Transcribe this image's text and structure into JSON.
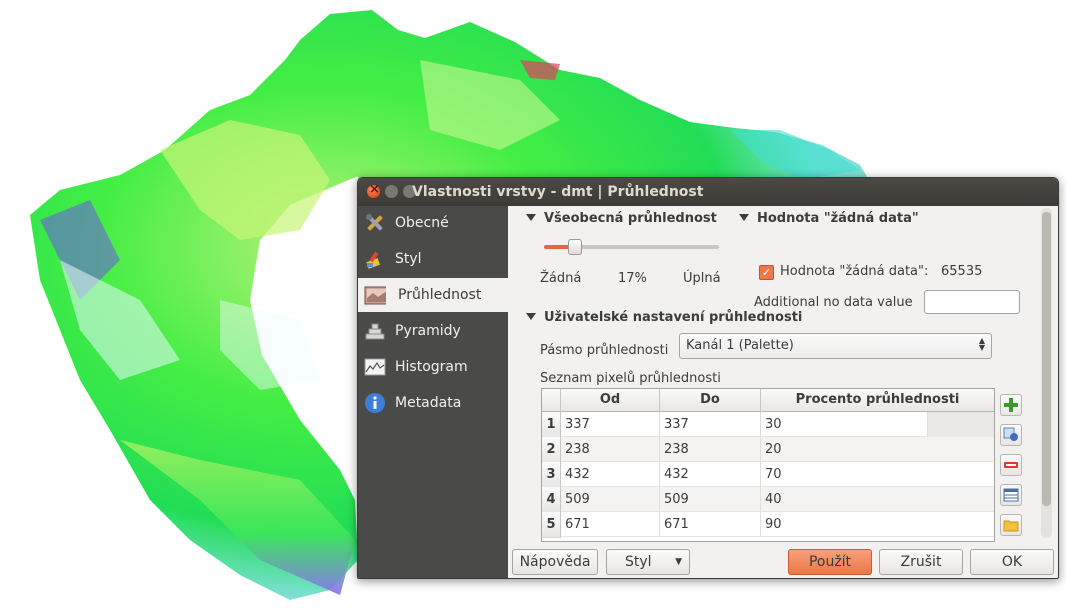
{
  "window": {
    "title": "Vlastnosti vrstvy - dmt | Průhlednost"
  },
  "sidebar": {
    "items": [
      {
        "label": "Obecné",
        "icon": "tools-icon"
      },
      {
        "label": "Styl",
        "icon": "paintbrush-icon"
      },
      {
        "label": "Průhlednost",
        "icon": "transparency-icon",
        "active": true
      },
      {
        "label": "Pyramidy",
        "icon": "pyramid-icon"
      },
      {
        "label": "Histogram",
        "icon": "histogram-icon"
      },
      {
        "label": "Metadata",
        "icon": "info-icon"
      }
    ]
  },
  "global_transparency": {
    "header": "Všeobecná průhlednost",
    "min_label": "Žádná",
    "value_label": "17%",
    "value": 0.17,
    "max_label": "Úplná"
  },
  "nodata": {
    "header": "Hodnota \"žádná data\"",
    "checkbox_label": "Hodnota \"žádná data\":",
    "checked": true,
    "value": "65535",
    "additional_label": "Additional no data value",
    "additional_value": ""
  },
  "custom": {
    "header": "Uživatelské nastavení průhlednosti",
    "band_label": "Pásmo průhlednosti",
    "band_value": "Kanál 1 (Palette)",
    "pixel_list_label": "Seznam pixelů průhlednosti",
    "columns": [
      "Od",
      "Do",
      "Procento průhlednosti"
    ],
    "rows": [
      {
        "num": "1",
        "from": "337",
        "to": "337",
        "percent": "30"
      },
      {
        "num": "2",
        "from": "238",
        "to": "238",
        "percent": "20"
      },
      {
        "num": "3",
        "from": "432",
        "to": "432",
        "percent": "70"
      },
      {
        "num": "4",
        "from": "509",
        "to": "509",
        "percent": "40"
      },
      {
        "num": "5",
        "from": "671",
        "to": "671",
        "percent": "90"
      }
    ]
  },
  "buttons": {
    "help": "Nápověda",
    "style": "Styl",
    "apply": "Použít",
    "cancel": "Zrušit",
    "ok": "OK"
  },
  "colors": {
    "accent": "#ee7646",
    "sidebar_bg": "#4a4a48",
    "title_bg": "#3c3b37"
  }
}
